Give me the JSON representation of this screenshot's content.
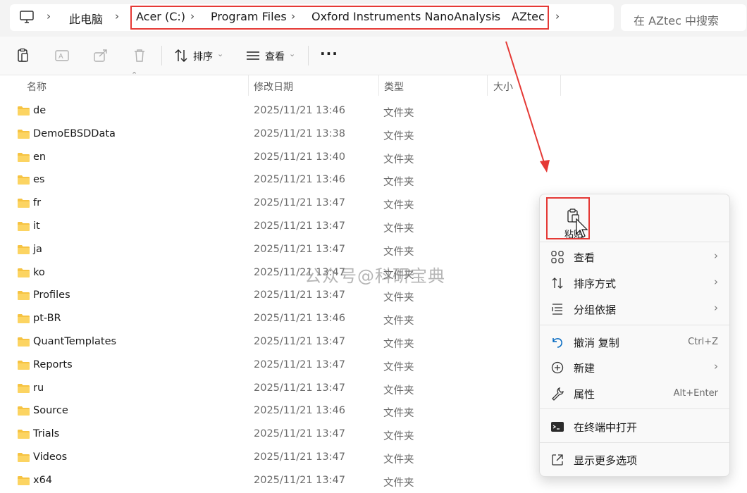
{
  "address_bar": {
    "breadcrumbs": [
      "此电脑",
      "Acer (C:)",
      "Program Files",
      "Oxford Instruments NanoAnalysis",
      "AZtec"
    ],
    "search_placeholder": "在 AZtec 中搜索"
  },
  "toolbar": {
    "sort_label": "排序",
    "view_label": "查看",
    "more_label": "···"
  },
  "columns": {
    "name": "名称",
    "modified": "修改日期",
    "type": "类型",
    "size": "大小"
  },
  "files": [
    {
      "name": "de",
      "modified": "2025/11/21 13:46",
      "type": "文件夹"
    },
    {
      "name": "DemoEBSDData",
      "modified": "2025/11/21 13:38",
      "type": "文件夹"
    },
    {
      "name": "en",
      "modified": "2025/11/21 13:40",
      "type": "文件夹"
    },
    {
      "name": "es",
      "modified": "2025/11/21 13:46",
      "type": "文件夹"
    },
    {
      "name": "fr",
      "modified": "2025/11/21 13:47",
      "type": "文件夹"
    },
    {
      "name": "it",
      "modified": "2025/11/21 13:47",
      "type": "文件夹"
    },
    {
      "name": "ja",
      "modified": "2025/11/21 13:47",
      "type": "文件夹"
    },
    {
      "name": "ko",
      "modified": "2025/11/21 13:47",
      "type": "文件夹"
    },
    {
      "name": "Profiles",
      "modified": "2025/11/21 13:47",
      "type": "文件夹"
    },
    {
      "name": "pt-BR",
      "modified": "2025/11/21 13:46",
      "type": "文件夹"
    },
    {
      "name": "QuantTemplates",
      "modified": "2025/11/21 13:47",
      "type": "文件夹"
    },
    {
      "name": "Reports",
      "modified": "2025/11/21 13:47",
      "type": "文件夹"
    },
    {
      "name": "ru",
      "modified": "2025/11/21 13:47",
      "type": "文件夹"
    },
    {
      "name": "Source",
      "modified": "2025/11/21 13:46",
      "type": "文件夹"
    },
    {
      "name": "Trials",
      "modified": "2025/11/21 13:47",
      "type": "文件夹"
    },
    {
      "name": "Videos",
      "modified": "2025/11/21 13:47",
      "type": "文件夹"
    },
    {
      "name": "x64",
      "modified": "2025/11/21 13:47",
      "type": "文件夹"
    }
  ],
  "watermark": "公众号@科研宝典",
  "context_menu": {
    "paste_label": "粘贴",
    "items": {
      "view": {
        "label": "查看",
        "icon": "view-grid-icon"
      },
      "sort": {
        "label": "排序方式",
        "icon": "sort-icon"
      },
      "group": {
        "label": "分组依据",
        "icon": "group-icon"
      },
      "undo": {
        "label": "撤消 复制",
        "shortcut": "Ctrl+Z",
        "icon": "undo-icon"
      },
      "new": {
        "label": "新建",
        "icon": "new-plus-icon"
      },
      "properties": {
        "label": "属性",
        "shortcut": "Alt+Enter",
        "icon": "wrench-icon"
      },
      "terminal": {
        "label": "在终端中打开",
        "icon": "terminal-icon"
      },
      "more_options": {
        "label": "显示更多选项",
        "icon": "open-external-icon"
      }
    }
  },
  "colors": {
    "highlight_red": "#e53935",
    "folder_yellow": "#f6c342",
    "accent_blue": "#0067c0"
  }
}
